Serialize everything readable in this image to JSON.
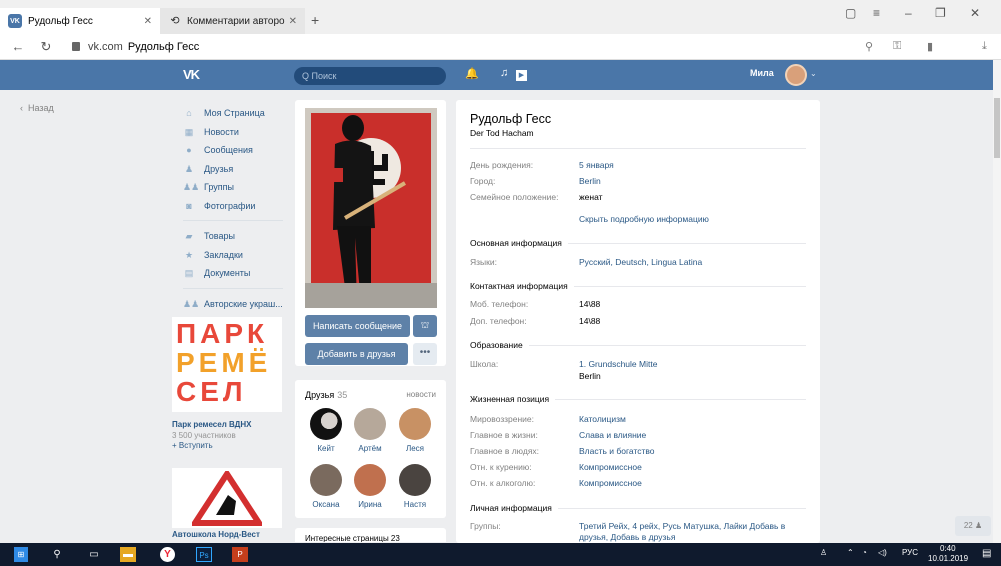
{
  "browser": {
    "tabs": [
      {
        "label": "Рудольф Гесс",
        "favicon": "vk-icon",
        "active": true
      },
      {
        "label": "Комментарии авторов \"Со",
        "favicon": "sync-icon",
        "active": false
      }
    ],
    "url_host": "vk.com",
    "url_title": "Рудольф Гесс"
  },
  "header": {
    "logo": "VK",
    "search_placeholder": "Q Поиск",
    "user_name": "Мила",
    "accent": "#4a76a8"
  },
  "left": {
    "back_label": "Назад",
    "menu": [
      {
        "label": "Моя Страница",
        "icon": "home-icon"
      },
      {
        "label": "Новости",
        "icon": "news-icon"
      },
      {
        "label": "Сообщения",
        "icon": "messages-icon"
      },
      {
        "label": "Друзья",
        "icon": "friends-icon"
      },
      {
        "label": "Группы",
        "icon": "groups-icon"
      },
      {
        "label": "Фотографии",
        "icon": "camera-icon"
      }
    ],
    "menu2": [
      {
        "label": "Товары",
        "icon": "bag-icon"
      },
      {
        "label": "Закладки",
        "icon": "star-icon"
      },
      {
        "label": "Документы",
        "icon": "document-icon"
      }
    ],
    "menu3": [
      {
        "label": "Авторские украш...",
        "icon": "group-icon"
      }
    ],
    "ad1": {
      "lines": [
        "ПАРК",
        "РЕМЁ",
        "СЕЛ"
      ],
      "title": "Парк ремесел ВДНХ",
      "members": "3 500 участников",
      "join": "+ Вступить"
    },
    "ad2": {
      "title": "Автошкола Норд-Вест"
    }
  },
  "profile": {
    "message_button": "Написать сообщение",
    "add_friend_button": "Добавить в друзья",
    "more_button": "•••",
    "friends_label": "Друзья",
    "friends_count": "35",
    "news_label": "новости",
    "friends": [
      "Кейт",
      "Артём",
      "Леся",
      "Оксана",
      "Ирина",
      "Настя"
    ],
    "interesting_label": "Интересные страницы  23"
  },
  "info": {
    "name": "Рудольф Гесс",
    "status": "Der Tod Hacham",
    "main_rows": [
      {
        "label": "День рождения:",
        "value": "5 января"
      },
      {
        "label": "Город:",
        "value": "Berlin"
      },
      {
        "label": "Семейное положение:",
        "value": "женат"
      }
    ],
    "hide_link": "Скрыть подробную информацию",
    "sec_basic": "Основная информация",
    "languages_label": "Языки:",
    "languages_value": "Русский, Deutsch, Lingua Latina",
    "sec_contact": "Контактная информация",
    "mobile_label": "Моб. телефон:",
    "mobile_value": "14\\88",
    "phone2_label": "Доп. телефон:",
    "phone2_value": "14\\88",
    "sec_education": "Образование",
    "school_label": "Школа:",
    "school_value": "1. Grundschule Mitte",
    "school_city": "Berlin",
    "sec_position": "Жизненная позиция",
    "position_rows": [
      {
        "label": "Мировоззрение:",
        "value": "Католицизм"
      },
      {
        "label": "Главное в жизни:",
        "value": "Слава и влияние"
      },
      {
        "label": "Главное в людях:",
        "value": "Власть и богатство"
      },
      {
        "label": "Отн. к курению:",
        "value": "Компромиссное"
      },
      {
        "label": "Отн. к алкоголю:",
        "value": "Компромиссное"
      }
    ],
    "sec_personal": "Личная информация",
    "groups_label": "Группы:",
    "groups_value": "Третий Рейх, 4 рейх, Русь Матушка, Лайки Добавь в друзья, Добавь в друзья"
  },
  "side_counter": "22",
  "taskbar": {
    "lang": "РУС",
    "time": "0:40",
    "date": "10.01.2019"
  }
}
